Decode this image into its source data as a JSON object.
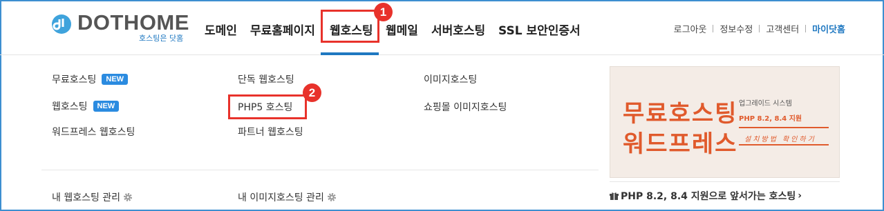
{
  "logo": {
    "text": "DOTHOME",
    "sub": "호스팅은 닷홈"
  },
  "gnb": [
    "도메인",
    "무료홈페이지",
    "웹호스팅",
    "웹메일",
    "서버호스팅",
    "SSL 보안인증서"
  ],
  "gnb_active": "웹호스팅",
  "util": {
    "logout": "로그아웃",
    "edit": "정보수정",
    "support": "고객센터",
    "mypage": "마이닷홈"
  },
  "steps": [
    "1",
    "2"
  ],
  "menu": {
    "col1": [
      "무료호스팅",
      "웹호스팅",
      "워드프레스 웹호스팅"
    ],
    "col2": [
      "단독 웹호스팅",
      "PHP5 호스팅",
      "파트너 웹호스팅"
    ],
    "col3": [
      "이미지호스팅",
      "쇼핑몰 이미지호스팅"
    ],
    "new_label": "NEW",
    "manage1": "내 웹호스팅 관리",
    "manage2": "내 이미지호스팅 관리"
  },
  "banner": {
    "title1": "무료호스팅",
    "title2": "워드프레스",
    "upgrade": "업그레이드 시스템",
    "php": "PHP 8.2, 8.4 지원",
    "how": "설치방법 확인하기"
  },
  "notice": "PHP 8.2, 8.4 지원으로 앞서가는 호스팅",
  "colors": {
    "accent": "#1f78c1",
    "highlight": "#e8322b",
    "banner_orange": "#e05a2c",
    "new_badge": "#2b8be0"
  }
}
